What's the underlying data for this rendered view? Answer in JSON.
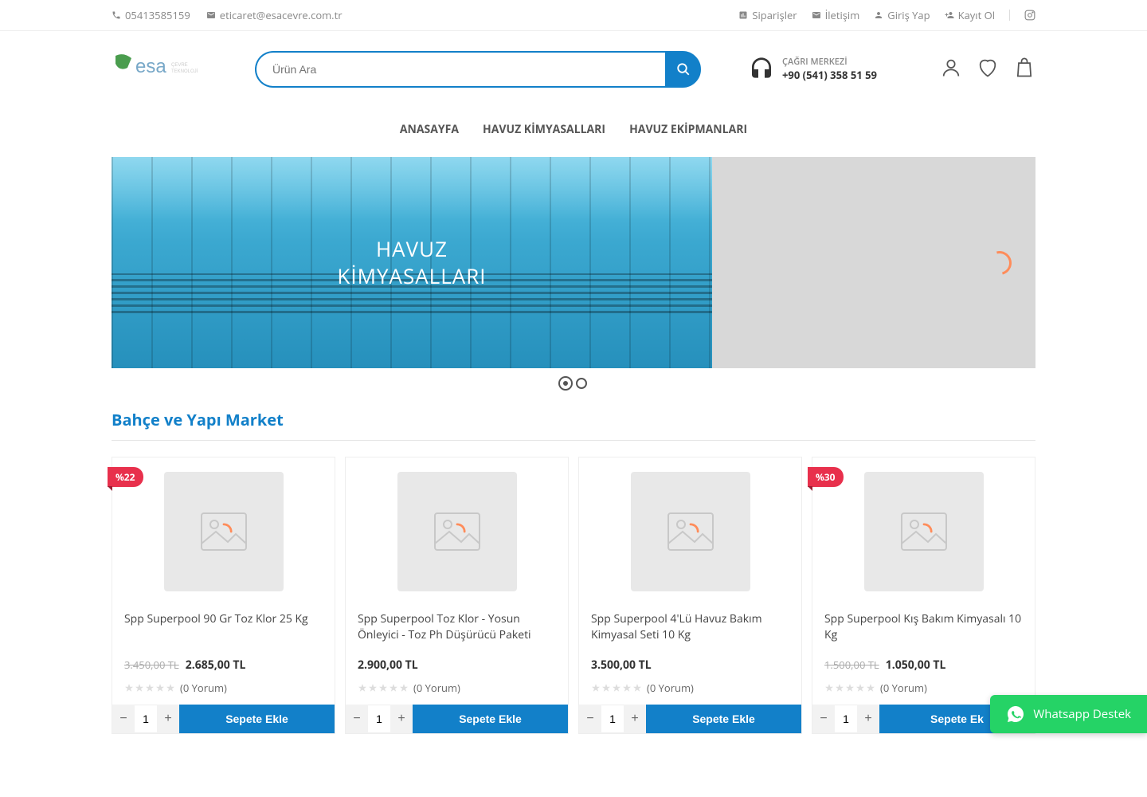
{
  "topbar": {
    "phone": "05413585159",
    "email": "eticaret@esacevre.com.tr",
    "links": {
      "orders": "Siparişler",
      "contact": "İletişim",
      "login": "Giriş Yap",
      "register": "Kayıt Ol"
    }
  },
  "search": {
    "placeholder": "Ürün Ara"
  },
  "call_center": {
    "label": "ÇAĞRI MERKEZİ",
    "number": "+90 (541) 358 51 59"
  },
  "nav": {
    "home": "ANASAYFA",
    "chemicals": "HAVUZ KİMYASALLARI",
    "equipment": "HAVUZ EKİPMANLARI"
  },
  "hero": {
    "line1": "HAVUZ",
    "line2": "KİMYASALLARI"
  },
  "section_title": "Bahçe ve Yapı Market",
  "products": [
    {
      "badge": "%22",
      "title": "Spp Superpool 90 Gr Toz Klor 25 Kg",
      "old_price": "3.450,00 TL",
      "price": "2.685,00 TL",
      "reviews": "(0 Yorum)",
      "qty": "1",
      "add": "Sepete Ekle"
    },
    {
      "badge": "",
      "title": "Spp Superpool Toz Klor - Yosun Önleyici - Toz Ph Düşürücü Paketi",
      "old_price": "",
      "price": "2.900,00 TL",
      "reviews": "(0 Yorum)",
      "qty": "1",
      "add": "Sepete Ekle"
    },
    {
      "badge": "",
      "title": "Spp Superpool 4'Lü Havuz Bakım Kimyasal Seti 10 Kg",
      "old_price": "",
      "price": "3.500,00 TL",
      "reviews": "(0 Yorum)",
      "qty": "1",
      "add": "Sepete Ekle"
    },
    {
      "badge": "%30",
      "title": "Spp Superpool Kış Bakım Kimyasalı 10 Kg",
      "old_price": "1.500,00 TL",
      "price": "1.050,00 TL",
      "reviews": "(0 Yorum)",
      "qty": "1",
      "add": "Sepete Ek"
    }
  ],
  "whatsapp": "Whatsapp Destek"
}
